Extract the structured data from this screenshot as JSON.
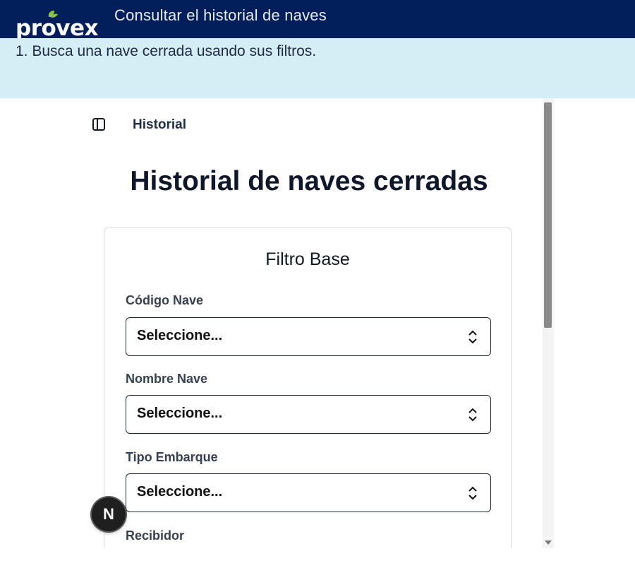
{
  "brand": {
    "logo_text": "provex",
    "colors": {
      "topbar_bg": "#021f5c",
      "instruction_bg": "#d5edf5",
      "logo_leaf": "#8cc63f"
    }
  },
  "header": {
    "title": "Consultar el historial de naves"
  },
  "instruction": {
    "text": "1. Busca una nave cerrada usando sus filtros."
  },
  "app": {
    "sidebar_toggle_icon": "sidebar-panel-icon",
    "breadcrumb": "Historial",
    "page_title": "Historial de naves cerradas",
    "filter_card": {
      "title": "Filtro Base",
      "fields": [
        {
          "label": "Código Nave",
          "value": "Seleccione..."
        },
        {
          "label": "Nombre Nave",
          "value": "Seleccione..."
        },
        {
          "label": "Tipo Embarque",
          "value": "Seleccione..."
        },
        {
          "label": "Recibidor"
        }
      ]
    },
    "badge_letter": "N"
  }
}
